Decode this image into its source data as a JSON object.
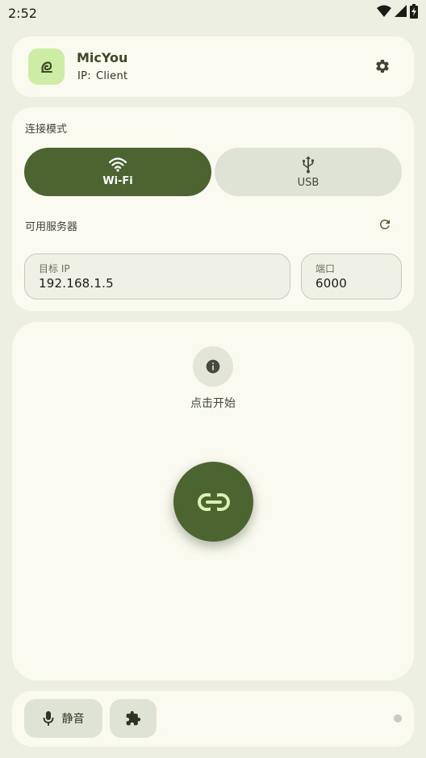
{
  "status_bar": {
    "time": "2:52",
    "icons": [
      "wifi-signal-icon",
      "cell-signal-icon",
      "battery-charging-icon"
    ]
  },
  "header": {
    "app_name": "MicYou",
    "ip_label": "IP:",
    "ip_value": "Client",
    "logo_icon": "app-logo-icon",
    "settings_icon": "gear-icon"
  },
  "connection": {
    "mode_label": "连接模式",
    "modes": [
      {
        "label": "Wi-Fi",
        "icon": "wifi-icon",
        "selected": true
      },
      {
        "label": "USB",
        "icon": "usb-icon",
        "selected": false
      }
    ],
    "servers_label": "可用服务器",
    "refresh_icon": "refresh-icon",
    "target_ip": {
      "label": "目标 IP",
      "value": "192.168.1.5"
    },
    "port": {
      "label": "端口",
      "value": "6000"
    }
  },
  "main": {
    "info_icon": "info-icon",
    "hint": "点击开始",
    "connect_icon": "link-icon"
  },
  "bottom_bar": {
    "mute_label": "静音",
    "mute_icon": "microphone-icon",
    "plugin_icon": "puzzle-icon",
    "status_dot": "inactive"
  },
  "colors": {
    "accent": "#4c6530",
    "accent_container": "#cdeda5",
    "background": "#eeefe3",
    "surface": "#fafaf0",
    "secondary_container": "#dfe3d5"
  }
}
